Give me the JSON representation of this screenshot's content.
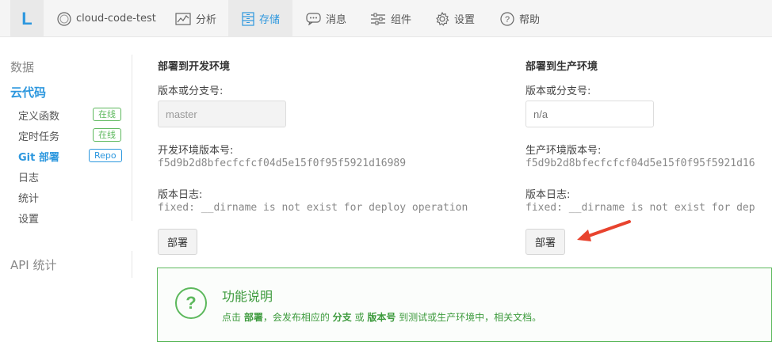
{
  "nav": {
    "logo": "L",
    "project": "cloud-code-test",
    "items": [
      {
        "label": "分析",
        "icon": "chart-icon"
      },
      {
        "label": "存储",
        "icon": "storage-icon"
      },
      {
        "label": "消息",
        "icon": "message-icon"
      },
      {
        "label": "组件",
        "icon": "components-icon"
      },
      {
        "label": "设置",
        "icon": "gear-icon"
      },
      {
        "label": "帮助",
        "icon": "help-icon"
      }
    ],
    "active": "存储"
  },
  "sidebar": {
    "data_heading": "数据",
    "cloud_heading": "云代码",
    "items": [
      {
        "label": "定义函数",
        "badge": "在线"
      },
      {
        "label": "定时任务",
        "badge": "在线"
      },
      {
        "label": "Git 部署",
        "badge": "Repo"
      },
      {
        "label": "日志"
      },
      {
        "label": "统计"
      },
      {
        "label": "设置"
      }
    ],
    "api_heading": "API 统计"
  },
  "dev": {
    "title": "部署到开发环境",
    "version_label": "版本或分支号:",
    "version_value": "master",
    "env_version_label": "开发环境版本号:",
    "env_version": "f5d9b2d8bfecfcfcf04d5e15f0f95f5921d16989",
    "log_label": "版本日志:",
    "log": "fixed: __dirname is not exist for deploy operation",
    "deploy": "部署"
  },
  "prod": {
    "title": "部署到生产环境",
    "version_label": "版本或分支号:",
    "version_placeholder": "n/a",
    "env_version_label": "生产环境版本号:",
    "env_version": "f5d9b2d8bfecfcfcf04d5e15f0f95f5921d16",
    "log_label": "版本日志:",
    "log": "fixed: __dirname is not exist for dep",
    "deploy": "部署"
  },
  "info": {
    "title": "功能说明",
    "p1": "点击 ",
    "b1": "部署",
    "p2": "，会发布相应的 ",
    "b2": "分支",
    "p3": " 或 ",
    "b3": "版本号",
    "p4": " 到测试或生产环境中，相关文档。"
  },
  "colors": {
    "accent": "#2c97de",
    "success": "#5cb85c",
    "arrow": "#e8432e"
  }
}
